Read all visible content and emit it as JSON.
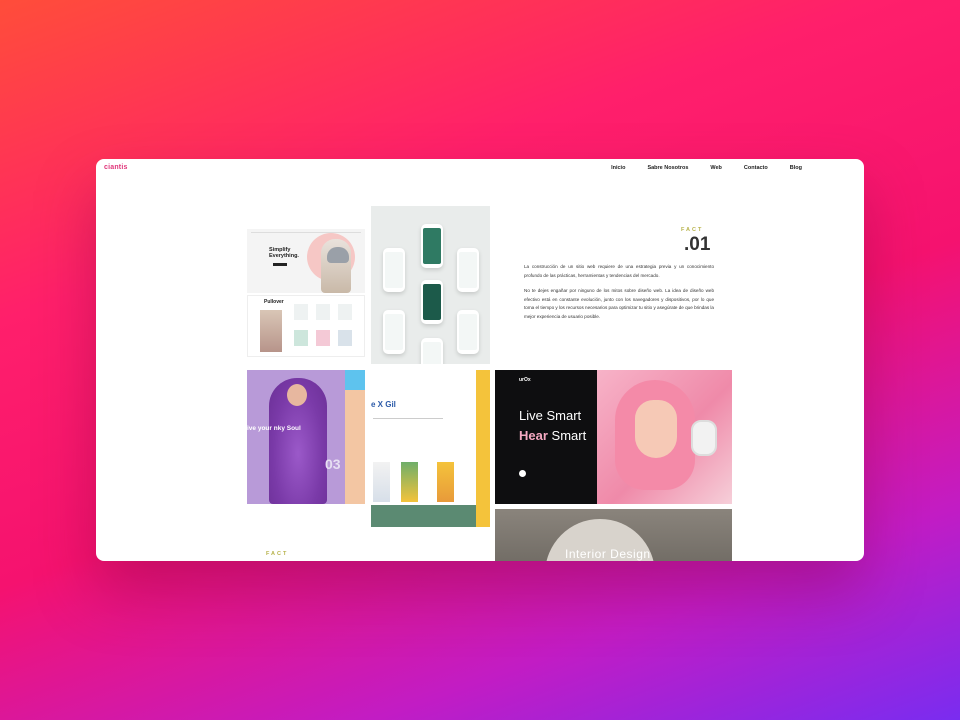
{
  "logo": {
    "text": "ciantis"
  },
  "nav": {
    "items": [
      "Inicio",
      "Sabre Nosotros",
      "Web",
      "Contacto",
      "Blog"
    ]
  },
  "fact": {
    "label": "FACT",
    "number": ".01",
    "paragraph1": "La construcción de un sitio web requiere de una estrategia previa y un conocimiento profundo de las prácticas, herramientas y tendencias del mercado.",
    "paragraph2": "No te dejes engañar por ninguno de los mitos sobre diseño web. La idea de diseño web efectivo está en constante evolución, junto con los navegadores y dispositivos, por lo que toma el tiempo y los recursos necesarios para optimizar tu sitio y asegúrate de que brindas la mejor experiencia de usuario posible."
  },
  "fact2": {
    "label": "FACT"
  },
  "tiles": {
    "simplify": {
      "headline": "Simplify Everything."
    },
    "pullover": {
      "brand": "Pullover"
    },
    "fashion": {
      "headline": "ive your nky Soul",
      "number": "03"
    },
    "gil": {
      "title": "e X Gil"
    },
    "smart": {
      "brand": "urOx",
      "line1": "Live Smart",
      "line2a": "Hear",
      "line2b": " Smart"
    },
    "interior": {
      "title": "Interior Design"
    }
  }
}
